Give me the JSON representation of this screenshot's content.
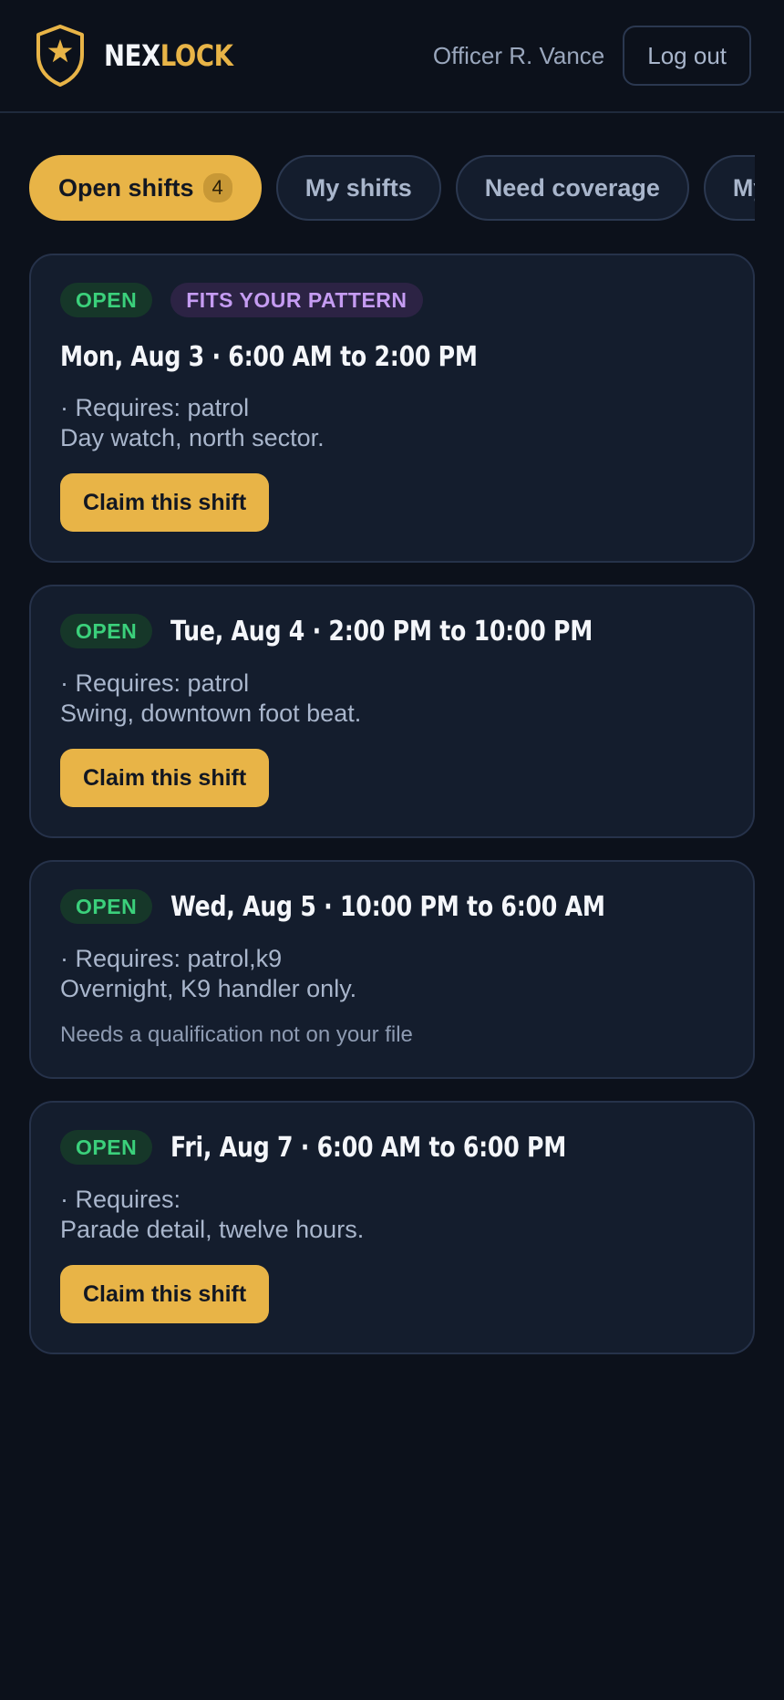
{
  "header": {
    "brand_part1": "NEX",
    "brand_part2": "LOCK",
    "officer_name": "Officer R. Vance",
    "logout_label": "Log out",
    "logo_icon": "shield-star-icon"
  },
  "tabs": [
    {
      "label": "Open shifts",
      "count": "4",
      "active": true
    },
    {
      "label": "My shifts"
    },
    {
      "label": "Need coverage"
    },
    {
      "label": "My"
    }
  ],
  "shifts": [
    {
      "status": "OPEN",
      "tag": "FITS YOUR PATTERN",
      "title": "Mon, Aug 3 · 6:00 AM to 2:00 PM",
      "requires": "· Requires: patrol",
      "description": "Day watch, north sector.",
      "action": "Claim this shift"
    },
    {
      "status": "OPEN",
      "title": "Tue, Aug 4 · 2:00 PM to 10:00 PM",
      "requires": "· Requires: patrol",
      "description": "Swing, downtown foot beat.",
      "action": "Claim this shift"
    },
    {
      "status": "OPEN",
      "title": "Wed, Aug 5 · 10:00 PM to 6:00 AM",
      "requires": "· Requires: patrol,k9",
      "description": "Overnight, K9 handler only.",
      "note": "Needs a qualification not on your file"
    },
    {
      "status": "OPEN",
      "title": "Fri, Aug 7 · 6:00 AM to 6:00 PM",
      "requires": "· Requires:",
      "description": "Parade detail, twelve hours.",
      "action": "Claim this shift"
    }
  ],
  "colors": {
    "background": "#0c111b",
    "card": "#141d2d",
    "accent": "#e8b447",
    "open_green": "#3bd07b",
    "tag_purple": "#c59cf2"
  }
}
